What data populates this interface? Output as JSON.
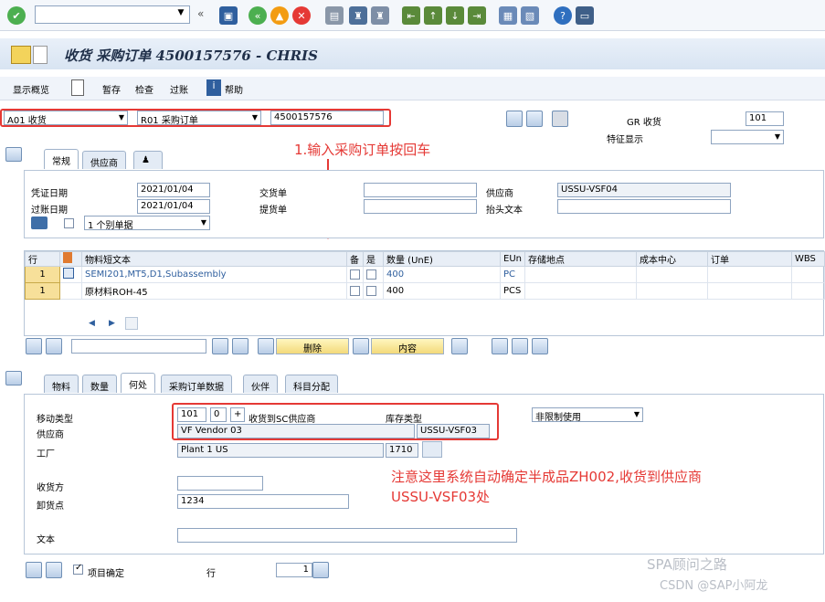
{
  "toolbar": {
    "command_value": ""
  },
  "title": {
    "text": "收货 采购订单 4500157576 - CHRIS"
  },
  "app_toolbar": {
    "items": [
      "显示概览",
      "暂存",
      "检查",
      "过账",
      "帮助"
    ]
  },
  "header": {
    "action": "A01 收货",
    "ref_doc": "R01 采购订单",
    "po_number": "4500157576",
    "gr_label": "GR 收货",
    "gr_value": "101",
    "feature_label": "特征显示"
  },
  "annotation1": "1.输入采购订单按回车",
  "tabs": {
    "top": [
      "常规",
      "供应商"
    ],
    "detail": [
      "物料",
      "数量",
      "何处",
      "采购订单数据",
      "伙伴",
      "科目分配"
    ]
  },
  "general": {
    "doc_date_label": "凭证日期",
    "doc_date": "2021/01/04",
    "post_date_label": "过账日期",
    "post_date": "2021/01/04",
    "delivery_note_label": "交货单",
    "bill_lading_label": "提货单",
    "vendor_label": "供应商",
    "vendor": "USSU-VSF04",
    "header_text_label": "抬头文本",
    "slip_option": "1 个别单据"
  },
  "table": {
    "headers": [
      "行",
      "",
      "物料短文本",
      "备",
      "是",
      "数量 (UnE)",
      "EUn",
      "存储地点",
      "成本中心",
      "订单",
      "WBS"
    ],
    "rows": [
      {
        "line": "1",
        "text": "SEMI201,MT5,D1,Subassembly",
        "qty": "400",
        "unit": "PC"
      },
      {
        "line": "1",
        "text": "原材料ROH-45",
        "qty": "400",
        "unit": "PCS"
      }
    ]
  },
  "grid_buttons": {
    "delete": "删除",
    "content": "内容"
  },
  "detail": {
    "mvt_label": "移动类型",
    "mvt": "101",
    "mvt_sub": "0",
    "mvt_plus": "+",
    "mvt_text": "收货到SC供应商",
    "stock_type_label": "库存类型",
    "stock_type": "非限制使用",
    "vendor_label": "供应商",
    "vendor_name": "VF Vendor 03",
    "vendor_code": "USSU-VSF03",
    "plant_label": "工厂",
    "plant_name": "Plant 1 US",
    "plant_code": "1710",
    "recipient_label": "收货方",
    "unload_label": "卸货点",
    "unload_value": "1234",
    "text_label": "文本"
  },
  "annotation2": {
    "line1": "注意这里系统自动确定半成品ZH002,收货到供应商",
    "line2": "USSU-VSF03处"
  },
  "footer": {
    "item_ok": "项目确定",
    "line_label": "行",
    "line_value": "1"
  },
  "watermark": {
    "line1": "SPA顾问之路",
    "line2": "CSDN @SAP小阿龙"
  }
}
